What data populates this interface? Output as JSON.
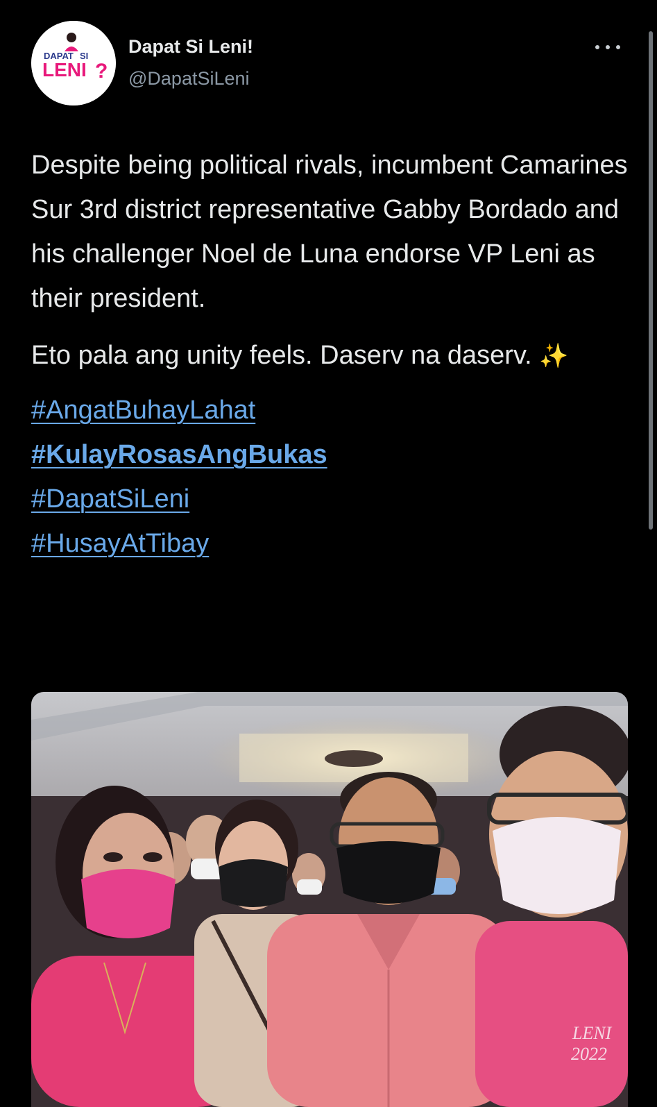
{
  "account": {
    "display_name": "Dapat Si Leni!",
    "handle": "@DapatSiLeni",
    "avatar_logo_text": "DAPAT SI LENI?"
  },
  "tweet": {
    "paragraph1": "Despite being political rivals, incumbent Camarines Sur 3rd district representative Gabby Bordado and his challenger Noel de Luna endorse VP Leni as their president.",
    "paragraph2": "Eto pala ang unity feels. Daserv na daserv.",
    "emoji": "✨",
    "hashtags": [
      "#AngatBuhayLahat",
      "#KulayRosasAngBukas",
      "#DapatSiLeni",
      "#HusayAtTibay"
    ]
  },
  "photo": {
    "shirt_print_text": "LENI 2022"
  },
  "icons": {
    "more": "more-horizontal-icon",
    "sparkles": "sparkles-emoji"
  },
  "colors": {
    "background": "#000000",
    "text": "#e7e9ea",
    "secondary_text": "#8b98a5",
    "hashtag": "#6aa9e9",
    "brand_pink": "#e8197b"
  }
}
